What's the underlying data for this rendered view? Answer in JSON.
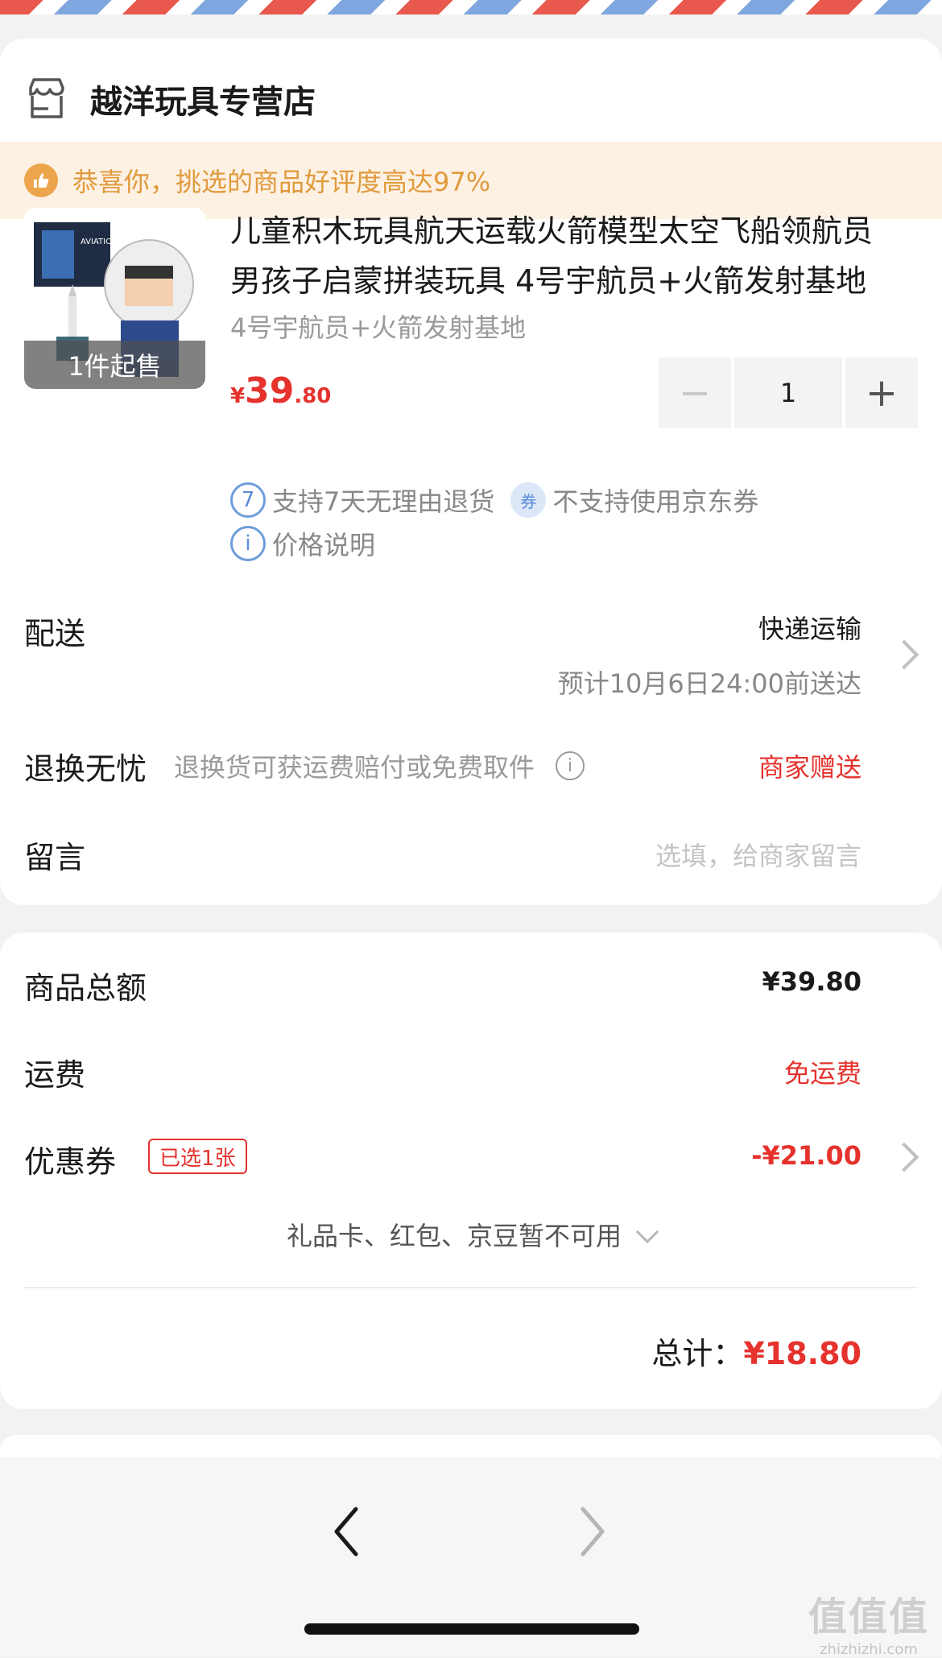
{
  "store": {
    "name": "越洋玩具专营店",
    "icon": "store-icon"
  },
  "banner": {
    "icon": "thumbs-up-icon",
    "text": "恭喜你，挑选的商品好评度高达97%"
  },
  "product": {
    "thumb_badge": "1件起售",
    "title": "儿童积木玩具航天运载火箭模型太空飞船领航员男孩子启蒙拼装玩具 4号宇航员+火箭发射基地",
    "spec": "4号宇航员+火箭发射基地",
    "price_symbol": "¥",
    "price_int": "39",
    "price_dec": ".80",
    "quantity": "1",
    "minus": "−",
    "plus": "+",
    "tag1_icon": "7",
    "tag1": "支持7天无理由退货",
    "tag2_icon": "券",
    "tag2": "不支持使用京东券",
    "tag3_icon": "i",
    "tag3": "价格说明"
  },
  "delivery": {
    "label": "配送",
    "method": "快递运输",
    "eta": "预计10月6日24:00前送达"
  },
  "returns": {
    "label": "退换无忧",
    "desc": "退换货可获运费赔付或免费取件",
    "info_icon": "i",
    "value": "商家赠送"
  },
  "message": {
    "label": "留言",
    "placeholder": "选填，给商家留言"
  },
  "summary": {
    "goods_label": "商品总额",
    "goods_value": "¥39.80",
    "shipping_label": "运费",
    "shipping_value": "免运费",
    "coupon_label": "优惠券",
    "coupon_badge": "已选1张",
    "coupon_value": "-¥21.00",
    "unavailable": "礼品卡、红包、京豆暂不可用",
    "total_label": "总计：",
    "total_value": "¥18.80"
  },
  "watermark": {
    "big": "值值值",
    "small": "zhizhizhi.com"
  },
  "colors": {
    "accent": "#e5322d",
    "banner_bg": "#fdf1e4",
    "banner_text": "#e09a3c",
    "tag_blue": "#5a8bd6"
  }
}
